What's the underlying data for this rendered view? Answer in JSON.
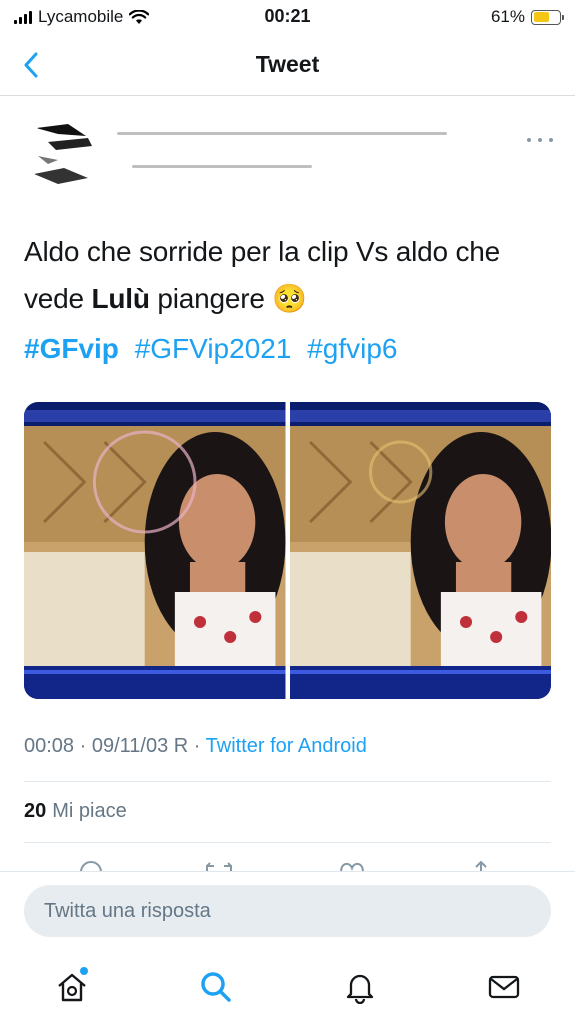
{
  "status_bar": {
    "carrier": "Lycamobile",
    "time": "00:21",
    "battery_percent": "61%",
    "battery_level": 0.61
  },
  "nav": {
    "title": "Tweet"
  },
  "tweet": {
    "text_plain_1": "Aldo che sorride per la clip Vs aldo che vede ",
    "text_bold": "Lulù",
    "text_plain_2": " piangere",
    "emoji": "🥺",
    "hashtags": [
      "#GFvip",
      "#GFVip2021",
      "#gfvip6"
    ],
    "time": "00:08",
    "date": "09/11/03 R",
    "source": "Twitter for Android",
    "like_count": "20",
    "like_label": "Mi piace"
  },
  "reply": {
    "placeholder": "Twitta una risposta"
  },
  "icons": {
    "back": "chevron-left-icon",
    "more": "more-dots-icon",
    "home": "home-icon",
    "search": "search-icon",
    "notifications": "bell-icon",
    "messages": "envelope-icon"
  },
  "colors": {
    "accent": "#1da1f2",
    "meta": "#657786",
    "battery": "#f5c518"
  }
}
